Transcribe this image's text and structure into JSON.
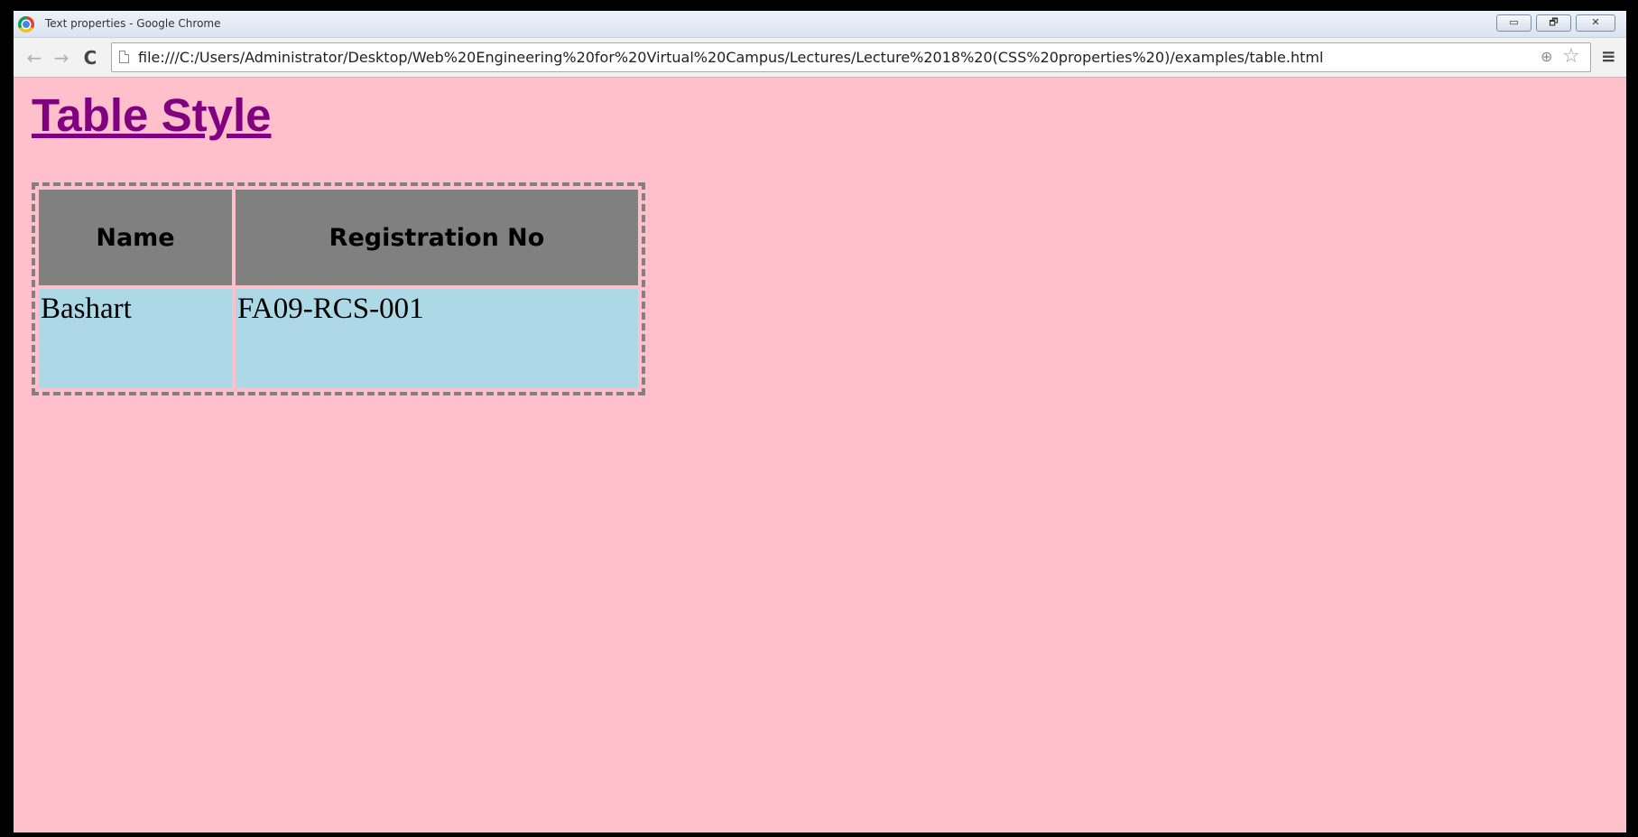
{
  "window": {
    "title": "Text properties - Google Chrome",
    "minimize_glyph": "▭",
    "maximize_glyph": "🗗",
    "close_glyph": "✕"
  },
  "toolbar": {
    "back_glyph": "←",
    "forward_glyph": "→",
    "reload_glyph": "C",
    "url": "file:///C:/Users/Administrator/Desktop/Web%20Engineering%20for%20Virtual%20Campus/Lectures/Lecture%2018%20(CSS%20properties%20)/examples/table.html",
    "zoom_glyph": "⊕",
    "star_glyph": "☆",
    "menu_glyph": "≡"
  },
  "page": {
    "heading": "Table Style",
    "background_color": "#ffc0cb",
    "heading_color": "#800080",
    "table": {
      "headers": [
        "Name",
        "Registration No"
      ],
      "rows": [
        [
          "Bashart",
          "FA09-RCS-001"
        ]
      ],
      "header_bg": "#808080",
      "cell_bg": "#add8e6",
      "border": "dashed #808080"
    }
  }
}
